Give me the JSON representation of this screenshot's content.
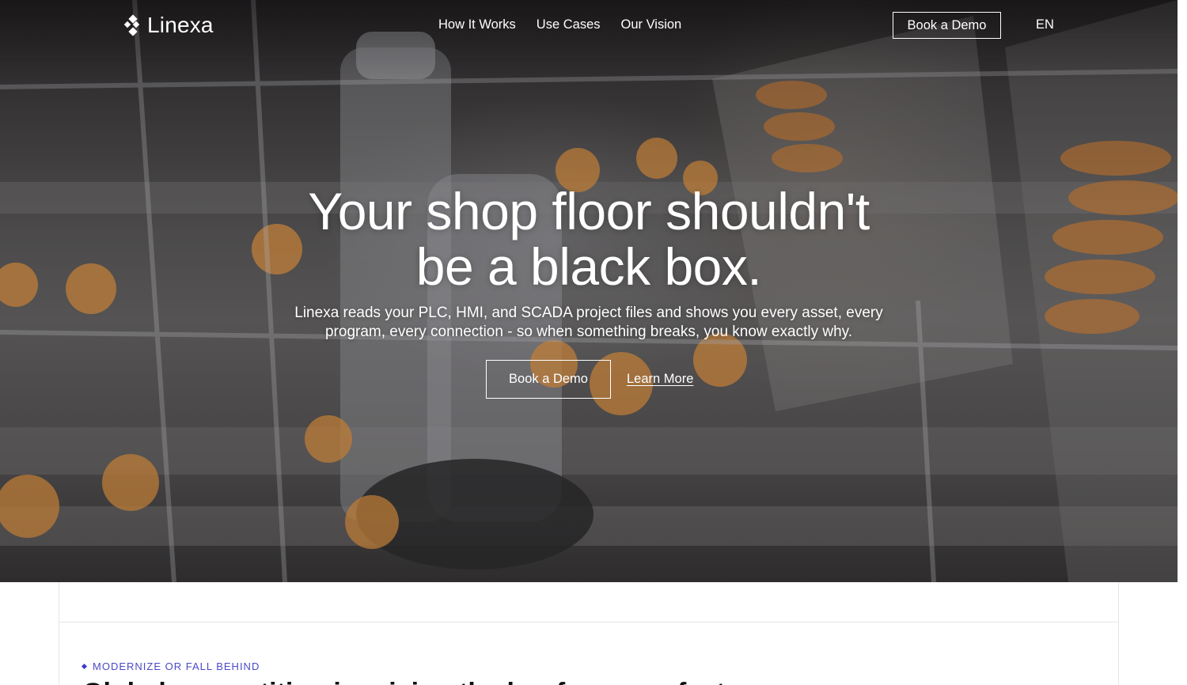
{
  "brand": {
    "name": "Linexa"
  },
  "nav": {
    "links": [
      "How It Works",
      "Use Cases",
      "Our Vision"
    ],
    "cta_label": "Book a Demo",
    "language": "EN"
  },
  "hero": {
    "headline_line1": "Your shop floor shouldn't",
    "headline_line2": "be a black box.",
    "subtext_line1": "Linexa reads your PLC, HMI, and SCADA project files and shows you every asset, every",
    "subtext_line2": "program, every connection - so when something breaks, you know exactly why.",
    "primary_cta": "Book a Demo",
    "secondary_link": "Learn More"
  },
  "section": {
    "eyebrow": "MODERNIZE OR FALL BEHIND",
    "heading_partial": "Global competition is raising the bar for every factory"
  },
  "colors": {
    "accent": "#4b49c8",
    "hero_text": "#ffffff",
    "page_bg": "#ffffff"
  }
}
